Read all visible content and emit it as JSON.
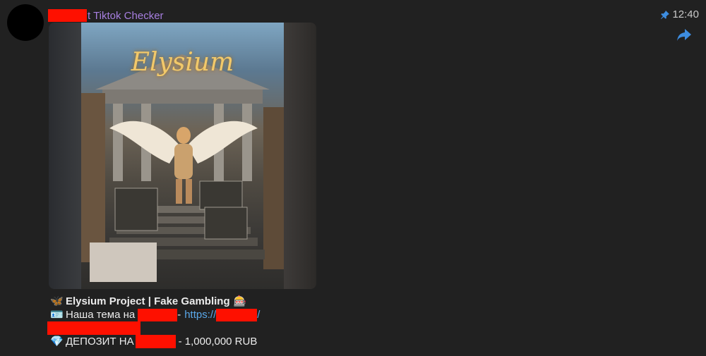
{
  "header": {
    "sender_suffix": "t Tiktok Checker",
    "time": "12:40",
    "pin_icon": "pin-icon",
    "share_icon": "share-icon"
  },
  "media": {
    "poster_title": "Elysium"
  },
  "caption": {
    "line1": "Elysium Project | Fake Gambling",
    "line2_prefix": "Наша тема на",
    "line2_dash": "-",
    "link_text": "https://",
    "link_suffix": "/",
    "line4_prefix": "ДЕПОЗИТ НА",
    "line4_suffix": "- 1,000,000 RUB",
    "emoji1": "🦋",
    "emoji1b": "🎰",
    "emoji2": "🪪",
    "emoji4": "💎"
  },
  "colors": {
    "background": "#212121",
    "sender": "#a77fe0",
    "link": "#5aa8ea",
    "redaction": "#fe1000"
  }
}
